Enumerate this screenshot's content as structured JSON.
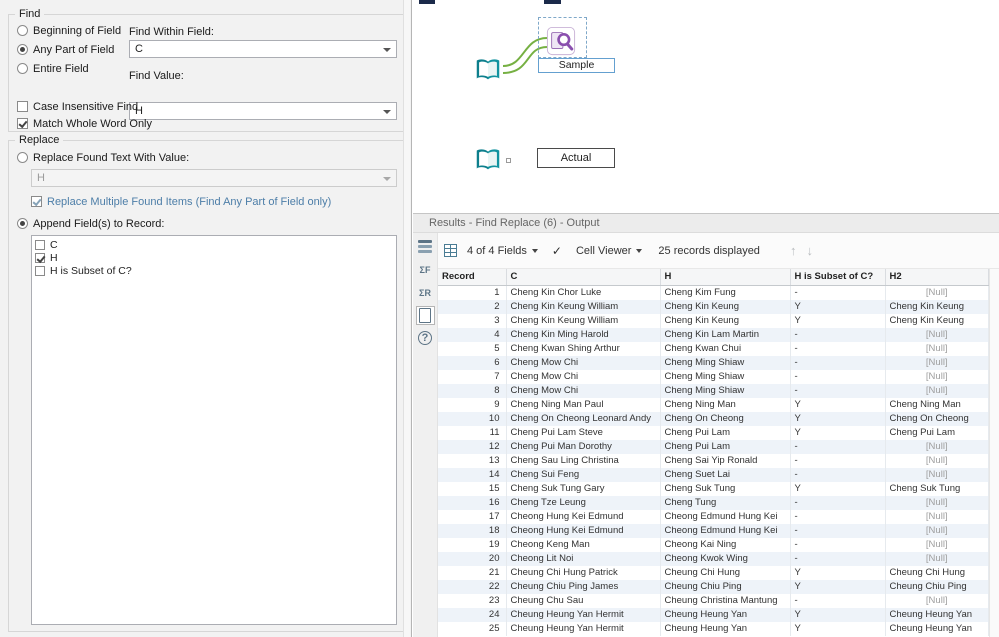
{
  "colors": {
    "accent_teal": "#0d7f8c",
    "tool_purple": "#8a4fae",
    "wire_green": "#76b043",
    "selection_blue": "#64a0d0",
    "null_gray": "#9e9e9e"
  },
  "config": {
    "find": {
      "group_label": "Find",
      "radios": [
        {
          "label": "Beginning of Field",
          "checked": false
        },
        {
          "label": "Any Part of Field",
          "checked": true
        },
        {
          "label": "Entire Field",
          "checked": false
        }
      ],
      "find_within_label": "Find Within Field:",
      "find_within_value": "C",
      "find_value_label": "Find Value:",
      "find_value_value": "H",
      "case_insensitive": {
        "label": "Case Insensitive Find",
        "checked": false
      },
      "match_whole_word": {
        "label": "Match Whole Word Only",
        "checked": true
      }
    },
    "replace": {
      "group_label": "Replace",
      "replace_radio": {
        "label": "Replace Found Text With Value:",
        "checked": false
      },
      "replace_value": "H",
      "multiple_checkbox": {
        "label": "Replace Multiple Found Items (Find Any Part of Field only)",
        "checked": true
      },
      "append_radio": {
        "label": "Append Field(s) to Record:",
        "checked": true
      },
      "fields": [
        {
          "label": "C",
          "checked": false
        },
        {
          "label": "H",
          "checked": true
        },
        {
          "label": "H is Subset of C?",
          "checked": false
        }
      ]
    }
  },
  "canvas": {
    "sample_label": "Sample",
    "actual_label": "Actual"
  },
  "results": {
    "title": "Results - Find Replace (6) - Output",
    "toolbar": {
      "fields_dropdown": "4 of 4 Fields",
      "cell_viewer": "Cell Viewer",
      "records_displayed": "25 records displayed"
    },
    "table": {
      "columns": [
        "Record",
        "C",
        "H",
        "H is Subset of C?",
        "H2"
      ],
      "rows": [
        [
          1,
          "Cheng Kin Chor Luke",
          "Cheng Kim Fung",
          "-",
          "[Null]"
        ],
        [
          2,
          "Cheng Kin Keung William",
          "Cheng Kin Keung",
          "Y",
          "Cheng Kin Keung"
        ],
        [
          3,
          "Cheng Kin Keung William",
          "Cheng Kin Keung",
          "Y",
          "Cheng Kin Keung"
        ],
        [
          4,
          "Cheng Kin Ming Harold",
          "Cheng Kin Lam Martin",
          "-",
          "[Null]"
        ],
        [
          5,
          "Cheng Kwan Shing Arthur",
          "Cheng Kwan Chui",
          "-",
          "[Null]"
        ],
        [
          6,
          "Cheng Mow Chi",
          "Cheng Ming Shiaw",
          "-",
          "[Null]"
        ],
        [
          7,
          "Cheng Mow Chi",
          "Cheng Ming Shiaw",
          "-",
          "[Null]"
        ],
        [
          8,
          "Cheng Mow Chi",
          "Cheng Ming Shiaw",
          "-",
          "[Null]"
        ],
        [
          9,
          "Cheng Ning Man Paul",
          "Cheng Ning Man",
          "Y",
          "Cheng Ning Man"
        ],
        [
          10,
          "Cheng On Cheong Leonard Andy",
          "Cheng On Cheong",
          "Y",
          "Cheng On Cheong"
        ],
        [
          11,
          "Cheng Pui Lam Steve",
          "Cheng Pui Lam",
          "Y",
          "Cheng Pui Lam"
        ],
        [
          12,
          "Cheng Pui Man Dorothy",
          "Cheng Pui Lam",
          "-",
          "[Null]"
        ],
        [
          13,
          "Cheng Sau Ling Christina",
          "Cheng Sai Yip Ronald",
          "-",
          "[Null]"
        ],
        [
          14,
          "Cheng Sui Feng",
          "Cheng Suet Lai",
          "-",
          "[Null]"
        ],
        [
          15,
          "Cheng Suk Tung Gary",
          "Cheng Suk Tung",
          "Y",
          "Cheng Suk Tung"
        ],
        [
          16,
          "Cheng Tze Leung",
          "Cheng Tung",
          "-",
          "[Null]"
        ],
        [
          17,
          "Cheong Hung Kei Edmund",
          "Cheong Edmund Hung Kei",
          "-",
          "[Null]"
        ],
        [
          18,
          "Cheong Hung Kei Edmund",
          "Cheong Edmund Hung Kei",
          "-",
          "[Null]"
        ],
        [
          19,
          "Cheong Keng Man",
          "Cheong Kai Ning",
          "-",
          "[Null]"
        ],
        [
          20,
          "Cheong Lit Noi",
          "Cheong Kwok Wing",
          "-",
          "[Null]"
        ],
        [
          21,
          "Cheung Chi Hung Patrick",
          "Cheung Chi Hung",
          "Y",
          "Cheung Chi Hung"
        ],
        [
          22,
          "Cheung Chiu Ping James",
          "Cheung Chiu Ping",
          "Y",
          "Cheung Chiu Ping"
        ],
        [
          23,
          "Cheung Chu Sau",
          "Cheung Christina Mantung",
          "-",
          "[Null]"
        ],
        [
          24,
          "Cheung Heung Yan Hermit",
          "Cheung Heung Yan",
          "Y",
          "Cheung Heung Yan"
        ],
        [
          25,
          "Cheung Heung Yan Hermit",
          "Cheung Heung Yan",
          "Y",
          "Cheung Heung Yan"
        ]
      ]
    }
  }
}
